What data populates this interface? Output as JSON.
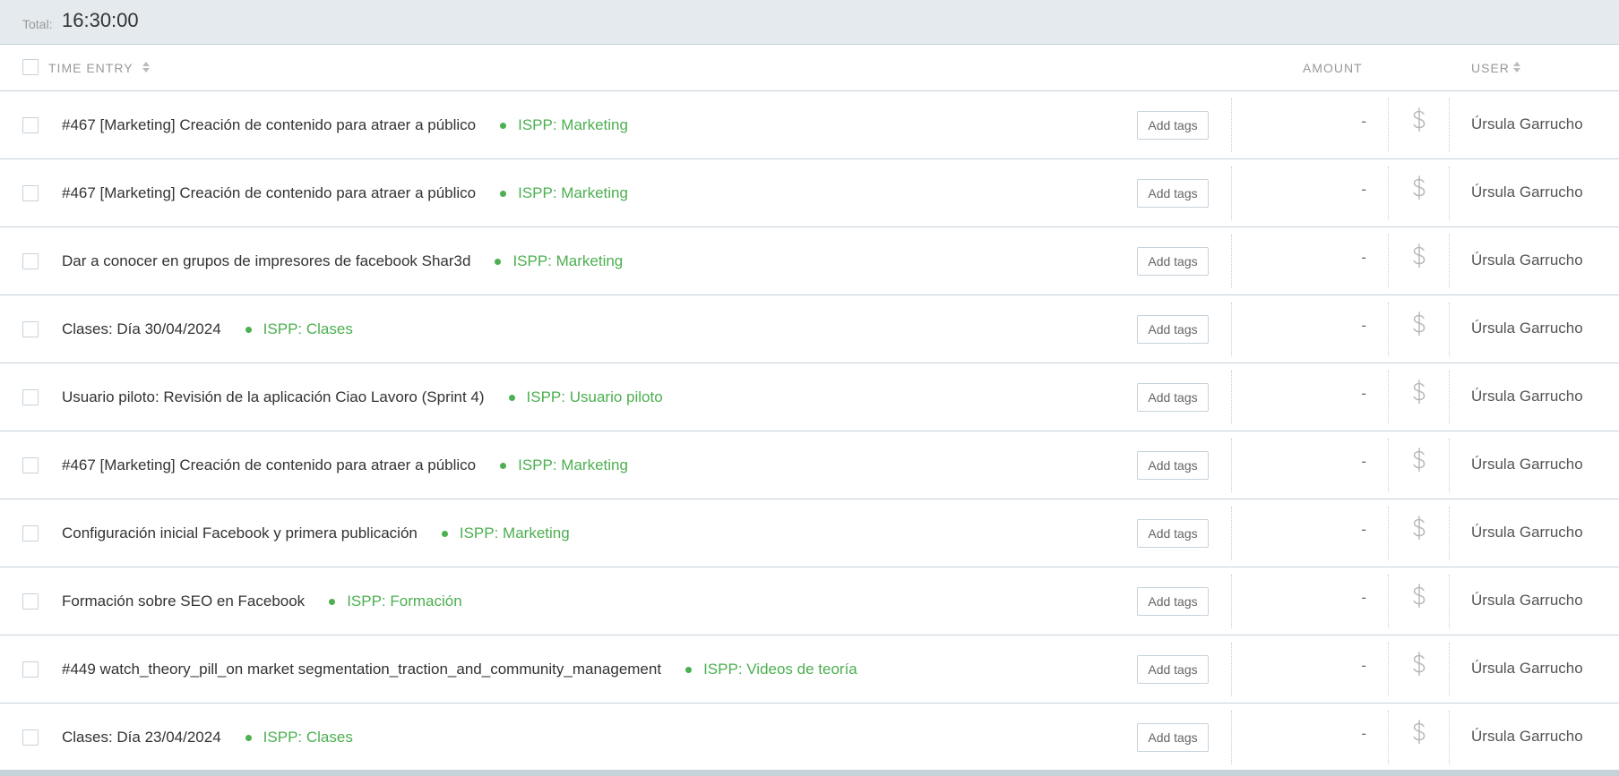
{
  "total": {
    "label": "Total:",
    "value": "16:30:00"
  },
  "header": {
    "time_entry": "TIME ENTRY",
    "amount": "AMOUNT",
    "user": "USER"
  },
  "add_tags_label": "Add tags",
  "project_color": "#4caf50",
  "billable_icon": "dollar-icon",
  "rows": [
    {
      "description": "#467 [Marketing] Creación de contenido para atraer a público",
      "project": "ISPP: Marketing",
      "amount": "-",
      "user": "Úrsula Garrucho"
    },
    {
      "description": "#467 [Marketing] Creación de contenido para atraer a público",
      "project": "ISPP: Marketing",
      "amount": "-",
      "user": "Úrsula Garrucho"
    },
    {
      "description": "Dar a conocer en grupos de impresores de facebook Shar3d",
      "project": "ISPP: Marketing",
      "amount": "-",
      "user": "Úrsula Garrucho"
    },
    {
      "description": "Clases: Día 30/04/2024",
      "project": "ISPP: Clases",
      "amount": "-",
      "user": "Úrsula Garrucho"
    },
    {
      "description": "Usuario piloto: Revisión de la aplicación Ciao Lavoro (Sprint 4)",
      "project": "ISPP: Usuario piloto",
      "amount": "-",
      "user": "Úrsula Garrucho"
    },
    {
      "description": "#467 [Marketing] Creación de contenido para atraer a público",
      "project": "ISPP: Marketing",
      "amount": "-",
      "user": "Úrsula Garrucho"
    },
    {
      "description": "Configuración inicial Facebook y primera publicación",
      "project": "ISPP: Marketing",
      "amount": "-",
      "user": "Úrsula Garrucho"
    },
    {
      "description": "Formación sobre SEO en Facebook",
      "project": "ISPP: Formación",
      "amount": "-",
      "user": "Úrsula Garrucho"
    },
    {
      "description": "#449 watch_theory_pill_on market segmentation_traction_and_community_management",
      "project": "ISPP: Videos de teoría",
      "amount": "-",
      "user": "Úrsula Garrucho"
    },
    {
      "description": "Clases: Día 23/04/2024",
      "project": "ISPP: Clases",
      "amount": "-",
      "user": "Úrsula Garrucho"
    }
  ]
}
